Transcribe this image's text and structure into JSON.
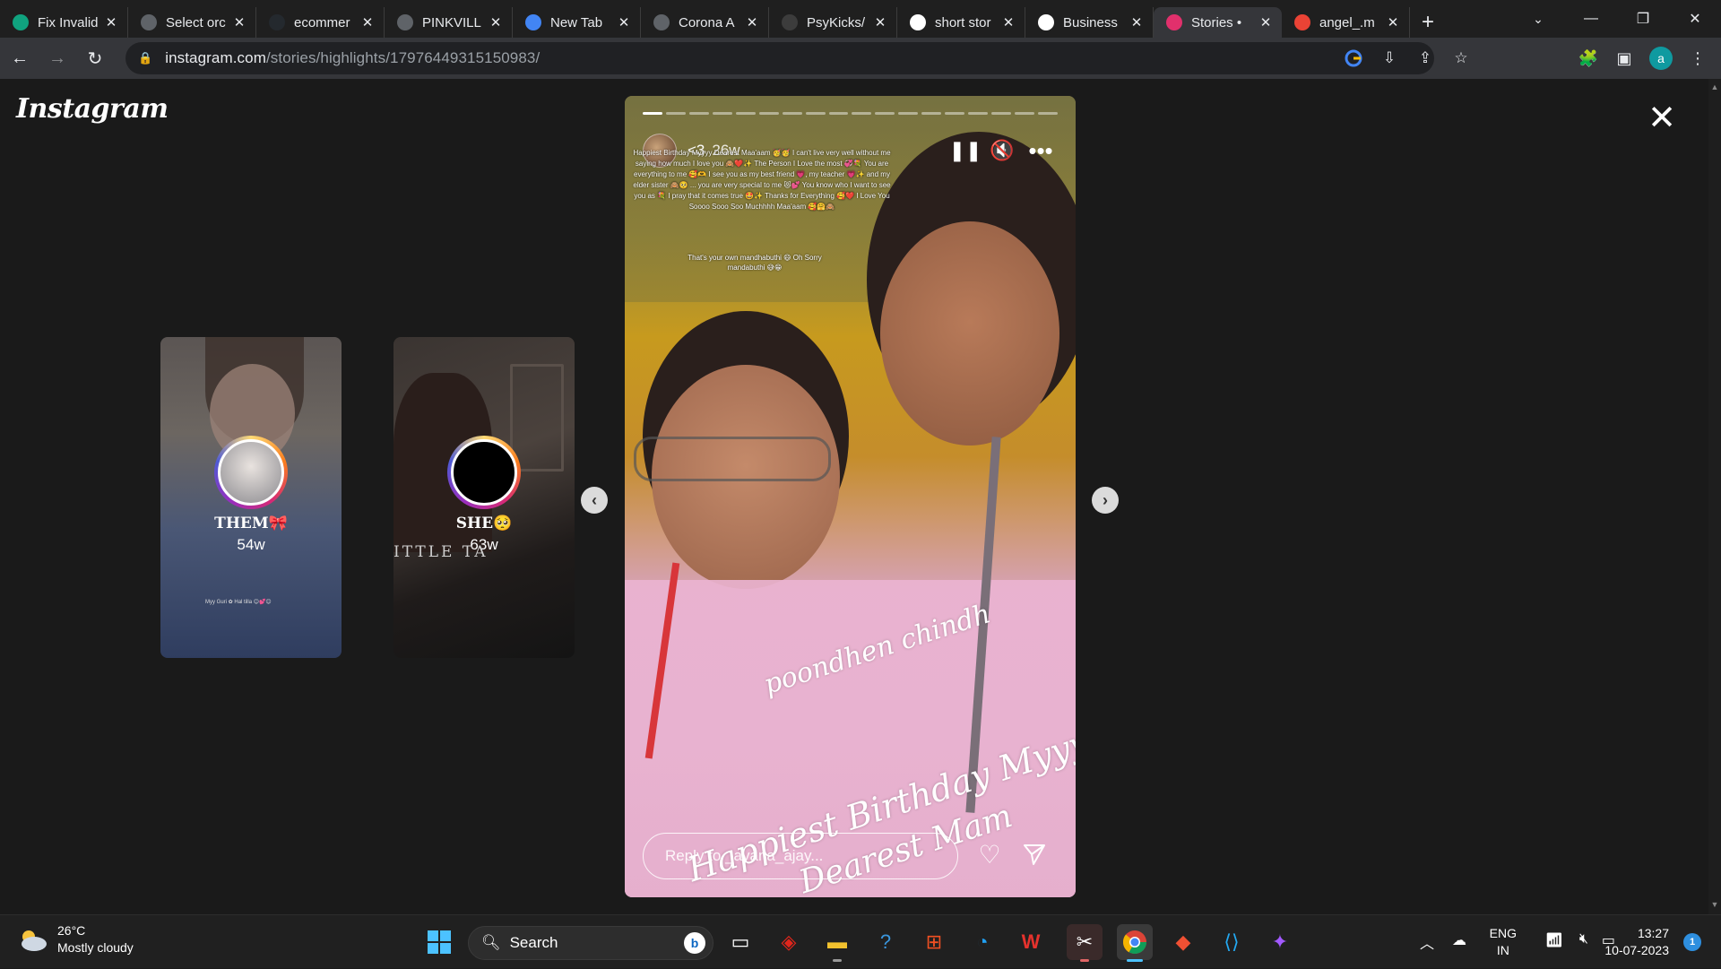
{
  "browser": {
    "tabs": [
      {
        "title": "Fix Invalid",
        "favicon": "chatgpt-icon",
        "color": "#10a37f"
      },
      {
        "title": "Select orc",
        "favicon": "globe-icon",
        "color": "#5f6368"
      },
      {
        "title": "ecommer",
        "favicon": "github-icon",
        "color": "#24292e"
      },
      {
        "title": "PINKVILL",
        "favicon": "globe-icon",
        "color": "#5f6368"
      },
      {
        "title": "New Tab",
        "favicon": "chrome-icon",
        "color": "#4285f4"
      },
      {
        "title": "Corona A",
        "favicon": "globe-icon",
        "color": "#5f6368"
      },
      {
        "title": "PsyKicks/",
        "favicon": "loading-icon",
        "color": "#3c3c3c"
      },
      {
        "title": "short stor",
        "favicon": "google-icon",
        "color": "#ffffff"
      },
      {
        "title": "Business",
        "favicon": "v-icon",
        "color": "#ffffff"
      },
      {
        "title": "Stories •",
        "favicon": "instagram-icon",
        "color": "#e1306c",
        "active": true
      },
      {
        "title": "angel_.m",
        "favicon": "gmail-icon",
        "color": "#ea4335"
      }
    ],
    "new_tab": "+",
    "address": {
      "host": "instagram.com",
      "path": "/stories/highlights/17976449315150983/"
    },
    "profile_initial": "a",
    "profile_color": "#0f9aa0"
  },
  "page": {
    "logo": "Instagram",
    "close": "✕",
    "prev_nav": "‹",
    "next_nav": "›",
    "highlights": [
      {
        "name": "THEM🎀",
        "time": "54w",
        "sticker": "Myy Guri ✿ Hal  tilla 😊💕😊"
      },
      {
        "name": "SHE🥺",
        "time": "63w",
        "banner": "ITTLE TA"
      }
    ],
    "story": {
      "progress_total": 18,
      "progress_done": 1,
      "user": "<3",
      "time": "26w",
      "caption": "Happiest Birthday Myyyy Dearest Maa'aam 🥳🥳 I can't live very well without me saying how much I love you 🙈❤️✨ The Person I Love the most 💞💐 You are everything to me 🥰🫶 I see you as my best friend 💗, my teacher 💗✨ and my elder sister 🙈🥺 ... you are very special to me 😻💕 You know who I want to see you as 💐 I pray that it comes true 🤩✨ Thanks for Everything 🥰❤️ I Love You Soooo Sooo Soo Muchhhh Maa'aam 🥰🤗🙈",
      "caption2": "That's your own mandhabuthi 😄 Oh Sorry mandabuthi 😅😁",
      "script_top": "poondhen chindh",
      "script_mid": "Happiest Birthday Myyy",
      "script_bottom": "Dearest Mam",
      "reply_placeholder": "Reply to _ayana_ajay..."
    }
  },
  "taskbar": {
    "weather_temp": "26°C",
    "weather_desc": "Mostly cloudy",
    "search_label": "Search",
    "lang_top": "ENG",
    "lang_bottom": "IN",
    "time": "13:27",
    "date": "10-07-2023",
    "notifications": "1"
  }
}
